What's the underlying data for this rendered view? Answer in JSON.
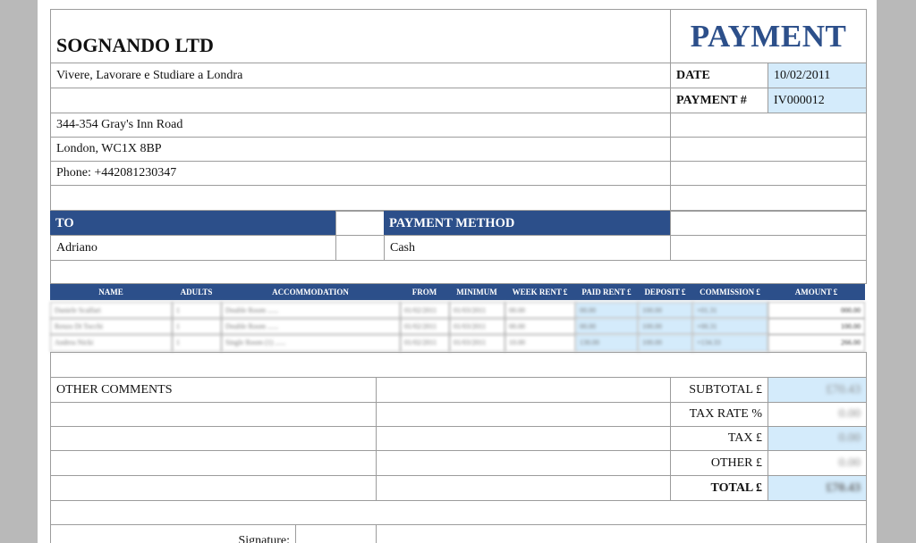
{
  "header": {
    "company": "SOGNANDO LTD",
    "doc_title": "PAYMENT",
    "tagline": "Vivere, Lavorare e Studiare a Londra",
    "address_line1": "344-354 Gray's Inn Road",
    "address_line2": "London, WC1X 8BP",
    "phone": "Phone: +442081230347"
  },
  "meta": {
    "date_label": "DATE",
    "date_value": "10/02/2011",
    "payment_no_label": "PAYMENT #",
    "payment_no_value": "IV000012"
  },
  "billing": {
    "to_label": "TO",
    "to_value": "Adriano",
    "method_label": "PAYMENT METHOD",
    "method_value": "Cash"
  },
  "table": {
    "headers": [
      "NAME",
      "ADULTS",
      "ACCOMMODATION",
      "FROM",
      "MINIMUM",
      "WEEK RENT £",
      "PAID RENT £",
      "DEPOSIT £",
      "COMMISSION £",
      "AMOUNT £"
    ],
    "rows": [
      [
        "Daniele Scalfari",
        "1",
        "Double Room ......",
        "01/02/2011",
        "01/03/2011",
        "00.00",
        "00.00",
        "100.00",
        "+01.31",
        "000.00"
      ],
      [
        "Renzo Di Tocchi",
        "1",
        "Double Room ......",
        "01/02/2011",
        "01/03/2011",
        "00.00",
        "00.00",
        "100.00",
        "+00.31",
        "100.00"
      ],
      [
        "Andrea Nicki",
        "1",
        "Single Room (1) ......",
        "01/02/2011",
        "01/03/2011",
        "10.00",
        "130.00",
        "100.00",
        "+134.33",
        "266.00"
      ]
    ]
  },
  "totals": {
    "comments_label": "OTHER COMMENTS",
    "subtotal_label": "SUBTOTAL £",
    "subtotal_value": "£70.43",
    "tax_rate_label": "TAX RATE %",
    "tax_rate_value": "0.00",
    "tax_label": "TAX £",
    "tax_value": "0.00",
    "other_label": "OTHER £",
    "other_value": "0.00",
    "total_label": "TOTAL £",
    "total_value": "£70.43"
  },
  "footer": {
    "signature_label": "Signature:"
  }
}
